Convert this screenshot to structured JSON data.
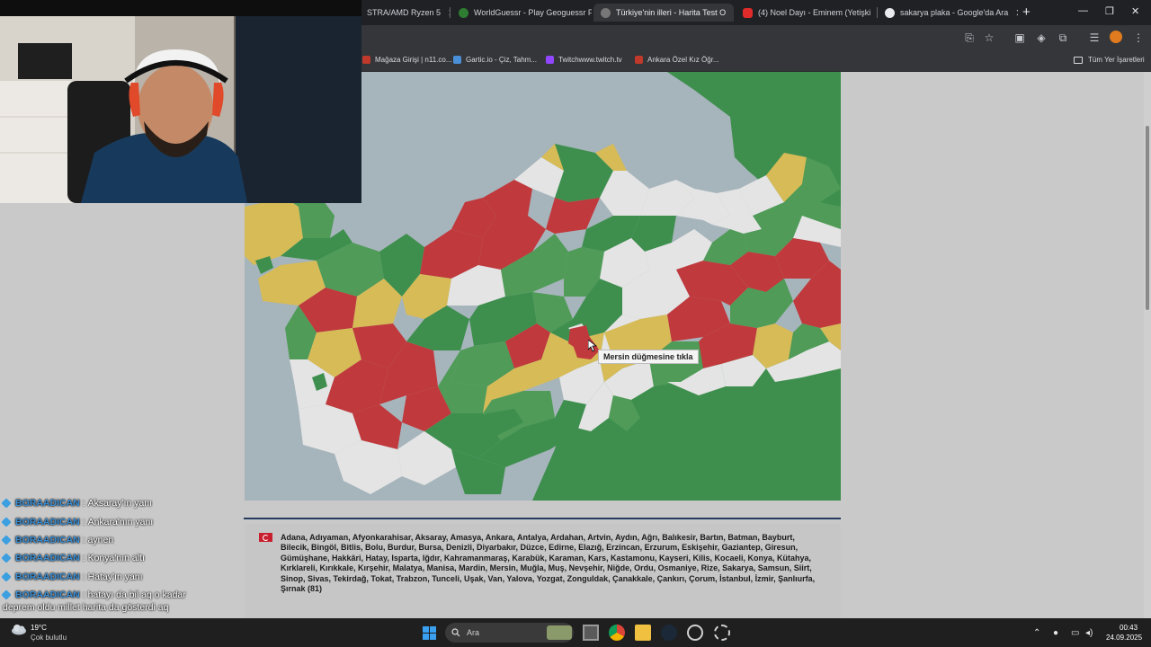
{
  "browser": {
    "tabs": [
      {
        "title": "STRA/AMD Ryzen 5",
        "active": false
      },
      {
        "title": "WorldGuessr - Play Geoguessr Fr",
        "active": false
      },
      {
        "title": "Türkiye'nin illeri - Harita Test O",
        "active": true
      },
      {
        "title": "(4) Noel Dayı - Eminem (Yetişki",
        "active": false
      },
      {
        "title": "sakarya plaka - Google'da Ara",
        "active": false
      }
    ],
    "close_glyph": "✕",
    "new_tab_glyph": "+",
    "window_controls": [
      "—",
      "❐",
      "✕"
    ],
    "bookmarks": [
      {
        "label": "Mağaza Girişi | n11.co...",
        "color": "#c0392b"
      },
      {
        "label": "Gartic.io - Çiz, Tahm...",
        "color": "#4a90d9"
      },
      {
        "label": "Twitchwww.twitch.tv",
        "color": "#9146ff"
      },
      {
        "label": "Ankara Özel Kız Öğr...",
        "color": "#c0392b"
      }
    ],
    "all_bookmarks_label": "Tüm Yer İşaretleri"
  },
  "map": {
    "tooltip": "Mersin düğmesine tıkla",
    "colors": {
      "sea": "#a6b4bb",
      "land_green": "#3e8f4e",
      "correct": "#4f9b57",
      "wrong": "#c0393c",
      "close": "#d7bb57",
      "unanswered": "#e4e4e4"
    }
  },
  "answer_list": {
    "text": "Adana, Adıyaman, Afyonkarahisar, Aksaray, Amasya, Ankara, Antalya, Ardahan, Artvin, Aydın, Ağrı, Balıkesir, Bartın, Batman, Bayburt, Bilecik, Bingöl, Bitlis, Bolu, Burdur, Bursa, Denizli, Diyarbakır, Düzce, Edirne, Elazığ, Erzincan, Erzurum, Eskişehir, Gaziantep, Giresun, Gümüşhane, Hakkâri, Hatay, Isparta, Iğdır, Kahramanmaraş, Karabük, Karaman, Kars, Kastamonu, Kayseri, Kilis, Kocaeli, Konya, Kütahya, Kırklareli, Kırıkkale, Kırşehir, Malatya, Manisa, Mardin, Mersin, Muğla, Muş, Nevşehir, Niğde, Ordu, Osmaniye, Rize, Sakarya, Samsun, Siirt, Sinop, Sivas, Tekirdağ, Tokat, Trabzon, Tunceli, Uşak, Van, Yalova, Yozgat, Zonguldak, Çanakkale, Çankırı, Çorum, İstanbul, İzmir, Şanlıurfa, Şırnak (81)"
  },
  "chat": {
    "messages": [
      {
        "user": "BORAADICAN",
        "text": "Aksaray'ın yanı"
      },
      {
        "user": "BORAADICAN",
        "text": "Ankara'nın yanı"
      },
      {
        "user": "BORAADICAN",
        "text": "aynen"
      },
      {
        "user": "BORAADICAN",
        "text": "Konya'nın altı"
      },
      {
        "user": "BORAADICAN",
        "text": "Hatay'ın yanı"
      },
      {
        "user": "BORAADICAN",
        "text": "hatayı da bil aq o kadar"
      }
    ],
    "separator": ":",
    "continuation": "deprem oldu millet harita da gösterdi aq"
  },
  "taskbar": {
    "weather_temp": "19°C",
    "weather_desc": "Çok bulutlu",
    "search_placeholder": "Ara",
    "tray_up": "⌃",
    "time": "00:43",
    "date": "24.09.2025"
  }
}
